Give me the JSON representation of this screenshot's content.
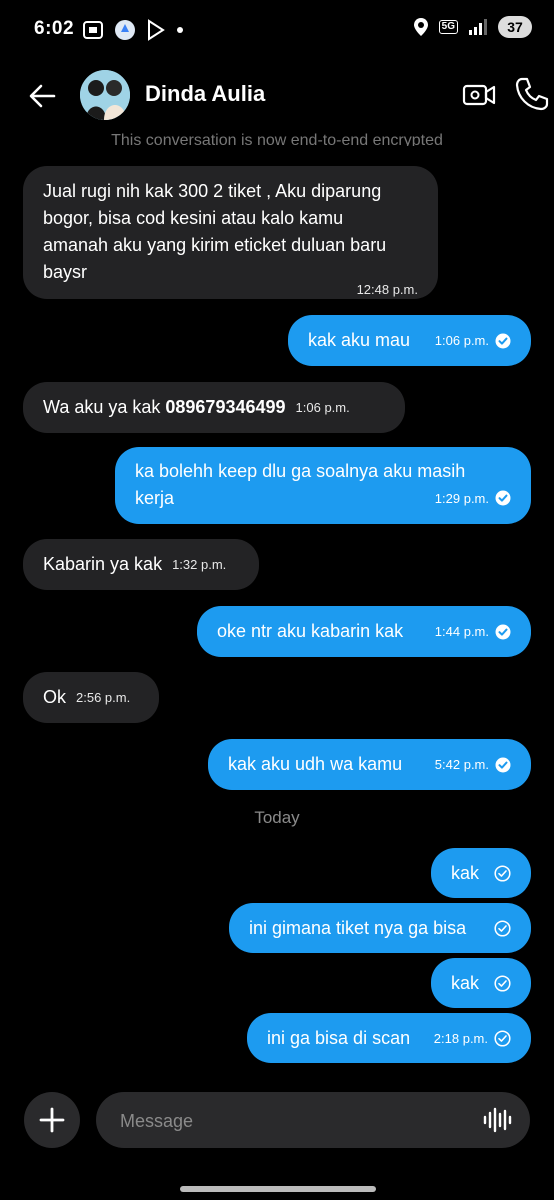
{
  "status_bar": {
    "time": "6:02",
    "battery": "37",
    "network": "5G"
  },
  "header": {
    "back_icon": "arrow-left-icon",
    "contact_name": "Dinda Aulia",
    "video_icon": "video-call-icon",
    "call_icon": "phone-icon"
  },
  "encryption_note": "This conversation is now end-to-end encrypted",
  "messages": [
    {
      "dir": "in",
      "lines": [
        "Jual rugi nih kak 300 2 tiket , Aku diparung",
        "bogor, bisa cod kesini atau kalo kamu",
        "amanah aku yang kirim eticket duluan baru",
        "baysr"
      ],
      "time": "12:48 p.m."
    },
    {
      "dir": "out",
      "text": "kak aku mau",
      "time": "1:06 p.m.",
      "status": "read"
    },
    {
      "dir": "in",
      "text_prefix": "Wa aku ya kak ",
      "text_bold": "089679346499",
      "time": "1:06 p.m."
    },
    {
      "dir": "out",
      "lines": [
        "ka bolehh keep dlu ga soalnya aku masih",
        "kerja"
      ],
      "time": "1:29 p.m.",
      "status": "read"
    },
    {
      "dir": "in",
      "text": "Kabarin ya kak",
      "time": "1:32 p.m."
    },
    {
      "dir": "out",
      "text": "oke ntr aku kabarin kak",
      "time": "1:44 p.m.",
      "status": "read"
    },
    {
      "dir": "in",
      "text": "Ok",
      "time": "2:56 p.m."
    },
    {
      "dir": "out",
      "text": "kak aku udh wa kamu",
      "time": "5:42 p.m.",
      "status": "read"
    },
    {
      "dir": "out",
      "text": "kak",
      "time": "",
      "status": "sent"
    },
    {
      "dir": "out",
      "text": "ini gimana tiket nya ga bisa",
      "time": "",
      "status": "sent"
    },
    {
      "dir": "out",
      "text": "kak",
      "time": "",
      "status": "sent"
    },
    {
      "dir": "out",
      "text": "ini ga bisa di scan",
      "time": "2:18 p.m.",
      "status": "sent"
    }
  ],
  "date_separator": "Today",
  "composer": {
    "placeholder": "Message",
    "add_icon": "plus-icon",
    "voice_icon": "voice-waveform-icon"
  },
  "colors": {
    "outgoing": "#1d9bf0",
    "incoming": "#232325",
    "background": "#000000"
  }
}
